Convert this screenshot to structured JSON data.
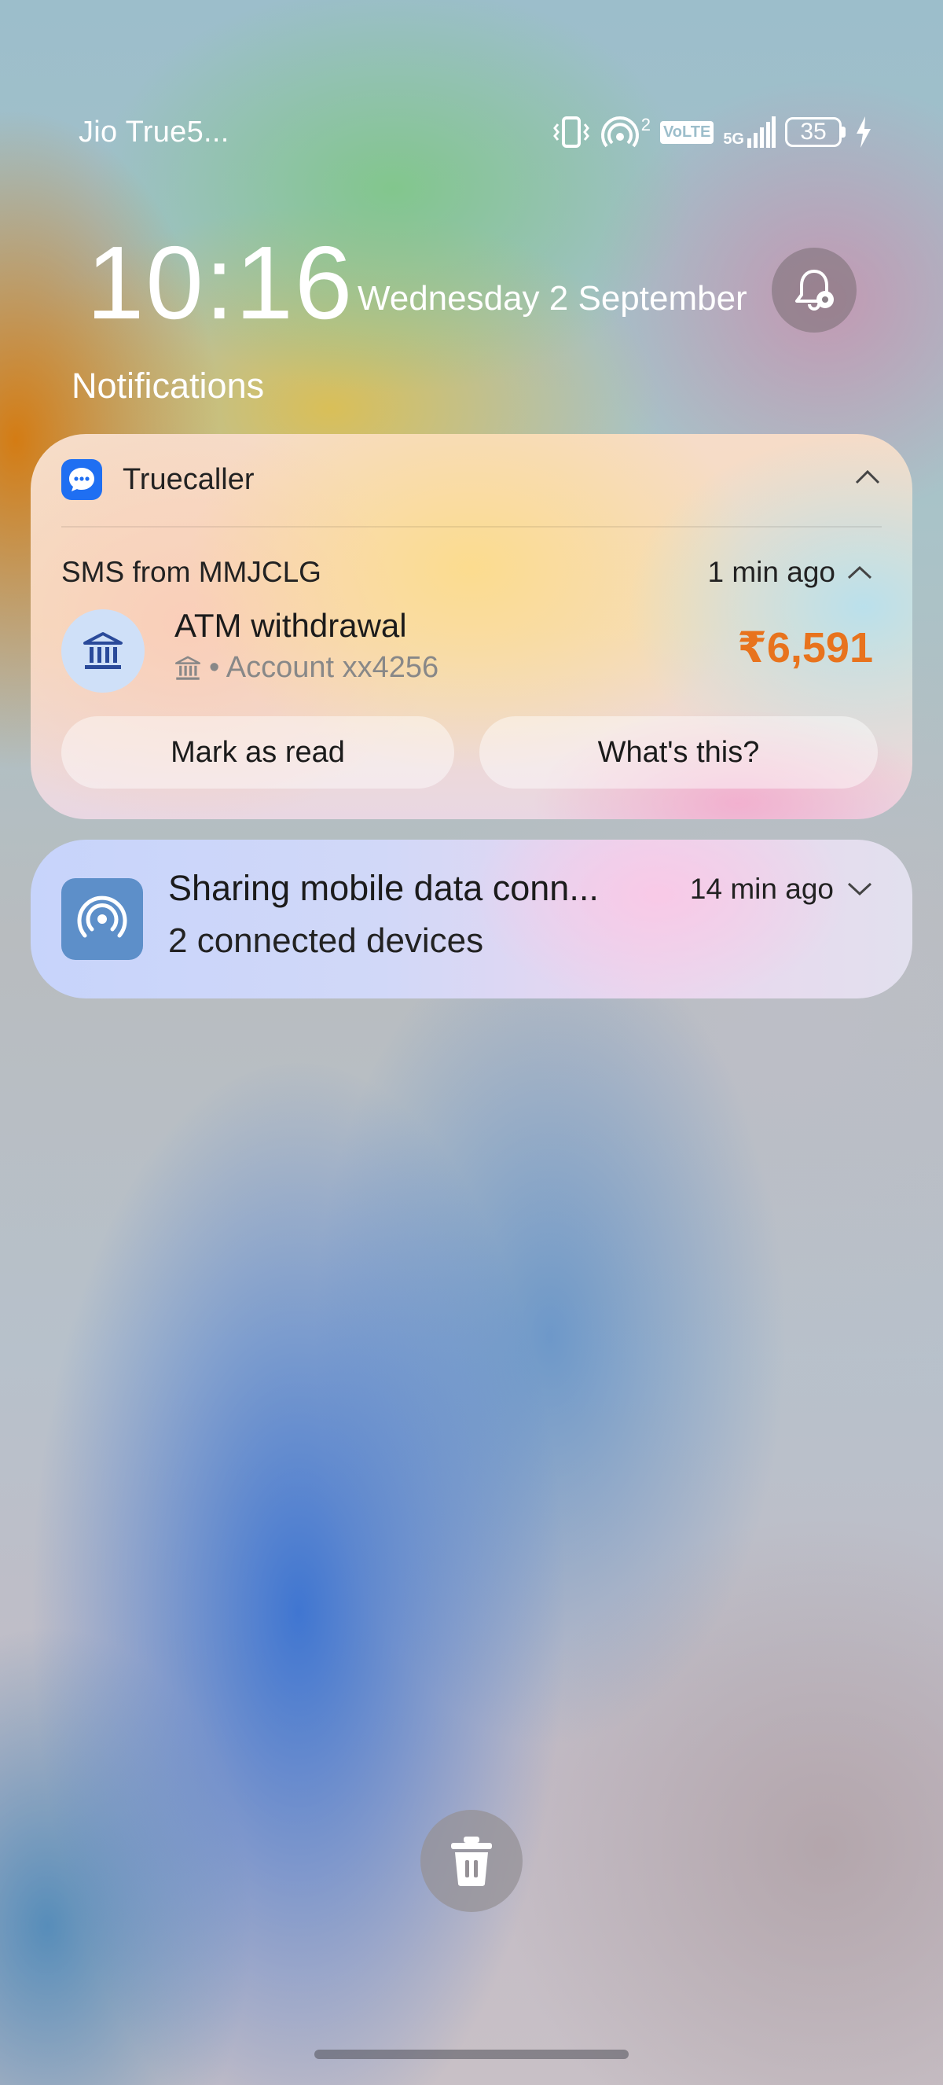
{
  "status_bar": {
    "carrier": "Jio True5...",
    "hotspot_devices": "2",
    "volte": "VoLTE",
    "network": "5G",
    "battery": "35",
    "icons": [
      "vibrate-icon",
      "hotspot-icon",
      "volte-icon",
      "signal-icon",
      "battery-icon",
      "charging-icon"
    ]
  },
  "lock": {
    "time": "10:16",
    "date": "Wednesday 2 September"
  },
  "notifications_heading": "Notifications",
  "notifications": [
    {
      "app": "Truecaller",
      "from": "SMS from MMJCLG",
      "time_ago": "1 min ago",
      "title": "ATM withdrawal",
      "subtitle": "• Account xx4256",
      "amount": "₹6,591",
      "actions": [
        "Mark as read",
        "What's this?"
      ]
    },
    {
      "title": "Sharing mobile data conn...",
      "subtitle": "2 connected devices",
      "time_ago": "14 min ago"
    }
  ],
  "colors": {
    "amount": "#e8731d",
    "truecaller_blue": "#1f6ff2",
    "hotspot_tile": "#5d8fc9"
  }
}
